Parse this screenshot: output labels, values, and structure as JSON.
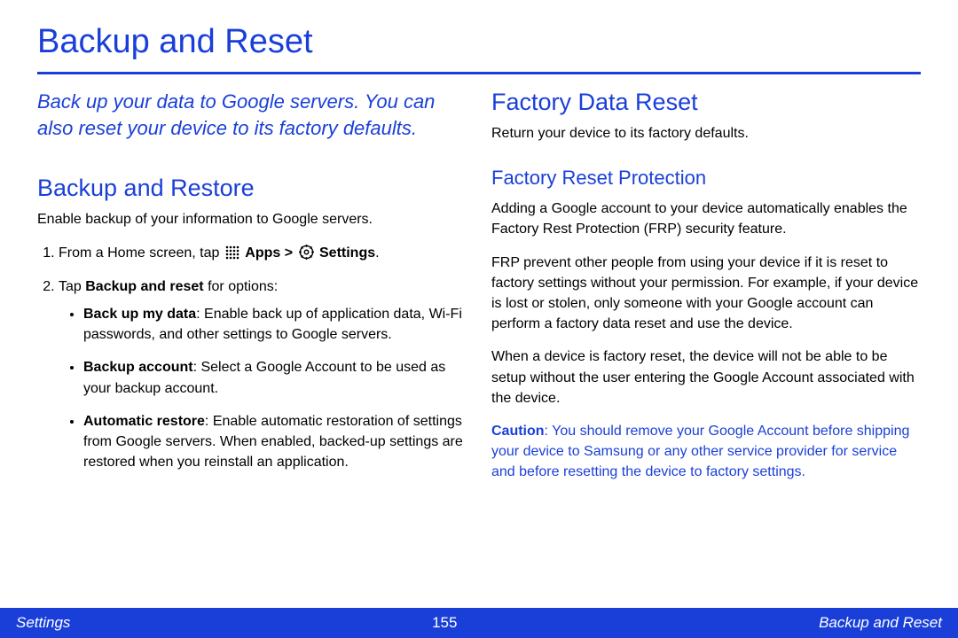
{
  "page_title": "Backup and Reset",
  "intro": "Back up your data to Google servers. You can also reset your device to its factory defaults.",
  "left": {
    "h2": "Backup and Restore",
    "lead": "Enable backup of your information to Google servers.",
    "step1_prefix": "From a Home screen, tap ",
    "step1_apps": "Apps",
    "step1_gt": " > ",
    "step1_settings": "Settings",
    "step1_dot": ".",
    "step2_prefix": "Tap ",
    "step2_bold": "Backup and reset",
    "step2_suffix": " for options:",
    "bullet1_bold": "Back up my data",
    "bullet1_rest": ": Enable back up of application data, Wi-Fi passwords, and other settings to Google servers.",
    "bullet2_bold": "Backup account",
    "bullet2_rest": ": Select a Google Account to be used as your backup account.",
    "bullet3_bold": "Automatic restore",
    "bullet3_rest": ": Enable automatic restoration of settings from Google servers. When enabled, backed-up settings are restored when you reinstall an application."
  },
  "right": {
    "h2": "Factory Data Reset",
    "lead": "Return your device to its factory defaults.",
    "h3": "Factory Reset Protection",
    "p1": "Adding a Google account to your device automatically enables the Factory Rest Protection (FRP) security feature.",
    "p2": "FRP prevent other people from using your device if it is reset to factory settings without your permission. For example, if your device is lost or stolen, only someone with your Google account can perform a factory data reset and use the device.",
    "p3": "When a device is factory reset, the device will not be able to be setup without the user entering the Google Account associated with the device.",
    "caution_label": "Caution",
    "caution_text": ": You should remove your Google Account before shipping your device to Samsung or any other service provider for service and before resetting the device to factory settings."
  },
  "footer": {
    "left": "Settings",
    "center": "155",
    "right": "Backup and Reset"
  }
}
